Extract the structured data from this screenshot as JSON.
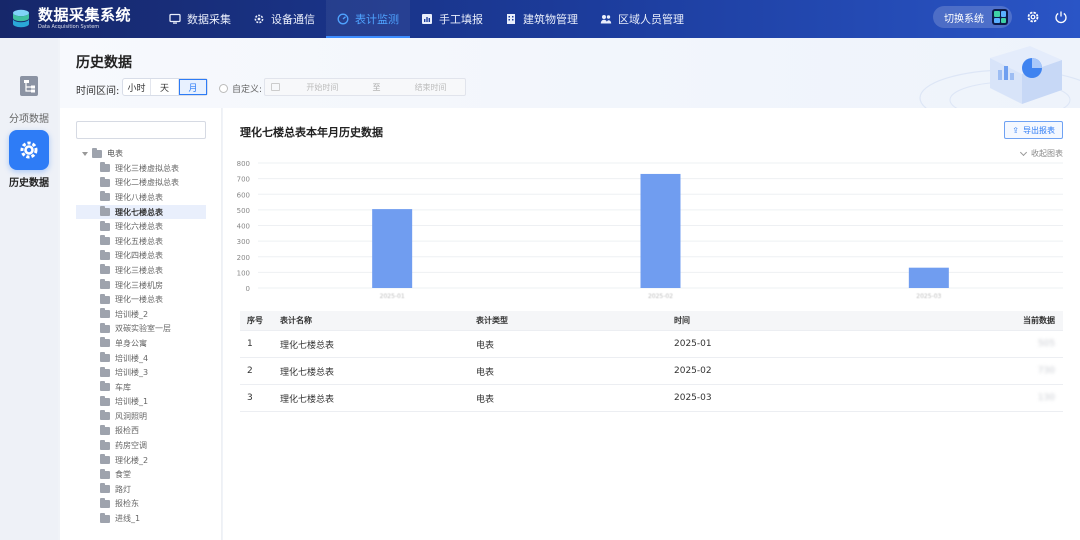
{
  "app": {
    "title": "数据采集系统",
    "subtitle": "Data Acquisition System",
    "nav": [
      {
        "label": "数据采集",
        "icon": "monitor-icon",
        "active": false
      },
      {
        "label": "设备通信",
        "icon": "gear-icon",
        "active": false
      },
      {
        "label": "表计监测",
        "icon": "gauge-icon",
        "active": true
      },
      {
        "label": "手工填报",
        "icon": "chart-icon",
        "active": false
      },
      {
        "label": "建筑物管理",
        "icon": "building-icon",
        "active": false
      },
      {
        "label": "区域人员管理",
        "icon": "people-icon",
        "active": false
      }
    ],
    "switch_label": "切换系统"
  },
  "rail": [
    {
      "label": "分项数据",
      "icon": "hierarchy-icon",
      "active": false
    },
    {
      "label": "历史数据",
      "icon": "gear-icon",
      "active": true
    }
  ],
  "header": {
    "title": "历史数据",
    "range_label": "时间区间:",
    "range_options": [
      "小时",
      "天",
      "月"
    ],
    "range_selected": "月",
    "custom_label": "自定义:",
    "start_placeholder": "开始时间",
    "to_label": "至",
    "end_placeholder": "结束时间"
  },
  "tree": {
    "root": "电表",
    "selected": "理化七楼总表",
    "items": [
      "理化三楼虚拟总表",
      "理化二楼虚拟总表",
      "理化八楼总表",
      "理化七楼总表",
      "理化六楼总表",
      "理化五楼总表",
      "理化四楼总表",
      "理化三楼总表",
      "理化三楼机房",
      "理化一楼总表",
      "培训楼_2",
      "双碳实验室一层",
      "单身公寓",
      "培训楼_4",
      "培训楼_3",
      "车库",
      "培训楼_1",
      "风洞照明",
      "报检西",
      "药房空调",
      "理化楼_2",
      "食堂",
      "路灯",
      "报检东",
      "进线_1"
    ]
  },
  "chart_panel": {
    "title": "理化七楼总表本年月历史数据",
    "export_label": "导出报表",
    "collapse_label": "收起图表"
  },
  "chart_data": {
    "type": "bar",
    "title": "",
    "xlabel": "",
    "ylabel": "",
    "categories": [
      "2025-01",
      "2025-02",
      "2025-03"
    ],
    "values": [
      505,
      730,
      130
    ],
    "ylim": [
      0,
      800
    ],
    "yticks": [
      0,
      100,
      200,
      300,
      400,
      500,
      600,
      700,
      800
    ],
    "grid": true,
    "color": "#709df0"
  },
  "table": {
    "headers": [
      "序号",
      "表计名称",
      "表计类型",
      "时间",
      "当前数据"
    ],
    "rows": [
      {
        "index": "1",
        "name": "理化七楼总表",
        "type": "电表",
        "time": "2025-01",
        "value": "505"
      },
      {
        "index": "2",
        "name": "理化七楼总表",
        "type": "电表",
        "time": "2025-02",
        "value": "730"
      },
      {
        "index": "3",
        "name": "理化七楼总表",
        "type": "电表",
        "time": "2025-03",
        "value": "130"
      }
    ]
  },
  "colors": {
    "accent": "#2e7cf6",
    "topbar": "#1c3c9c",
    "bar": "#709df0"
  }
}
